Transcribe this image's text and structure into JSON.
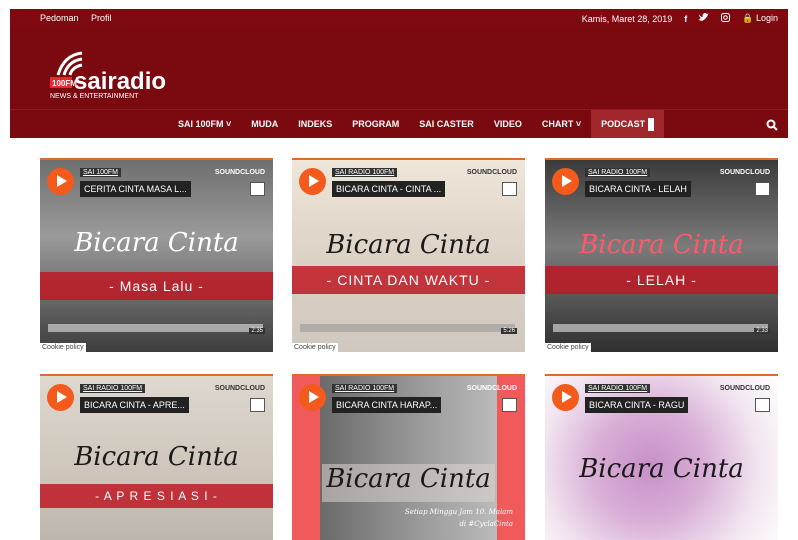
{
  "topbar": {
    "links": [
      "Pedoman",
      "Profil"
    ],
    "date": "Kamis, Maret 28, 2019",
    "login_label": "Login"
  },
  "brand": {
    "logo_number": "100FM",
    "logo_name": "sairadio",
    "tagline": "NEWS & ENTERTAINMENT",
    "color": "#7a0a10"
  },
  "nav": {
    "items": [
      {
        "label": "SAI 100FM ˅"
      },
      {
        "label": "MUDA"
      },
      {
        "label": "INDEKS"
      },
      {
        "label": "PROGRAM"
      },
      {
        "label": "SAI CASTER"
      },
      {
        "label": "VIDEO"
      },
      {
        "label": "CHART ˅"
      },
      {
        "label": "PODCAST"
      }
    ]
  },
  "cards": [
    {
      "user": "SAI 100FM",
      "source": "SOUNDCLOUD",
      "title": "CERITA CINTA MASA L...",
      "script": "Bicara Cinta",
      "band": "- Masa Lalu -",
      "time": "2:35",
      "cookie": "Cookie policy"
    },
    {
      "user": "SAI RADIO 100FM",
      "source": "SOUNDCLOUD",
      "title": "BICARA CINTA - CINTA ...",
      "script": "Bicara Cinta",
      "band": "- CINTA DAN WAKTU -",
      "time": "5:26",
      "cookie": "Cookie policy"
    },
    {
      "user": "SAI RADIO 100FM",
      "source": "SOUNDCLOUD",
      "title": "BICARA CINTA - LELAH",
      "script": "Bicara Cinta",
      "band": "- LELAH -",
      "time": "2:33",
      "cookie": "Cookie policy"
    },
    {
      "user": "SAI RADIO 100FM",
      "source": "SOUNDCLOUD",
      "title": "BICARA CINTA - APRE...",
      "script": "Bicara Cinta",
      "band": "- A P R E S I A S I -",
      "time": "",
      "cookie": ""
    },
    {
      "user": "SAI RADIO 100FM",
      "source": "SOUNDCLOUD",
      "title": "BICARA CINTA HARAP...",
      "script": "Bicara Cinta",
      "band": "",
      "sub1": "Setiap Minggu Jam 10. Malam",
      "sub2": "di #CyclaCinta",
      "time": "",
      "cookie": ""
    },
    {
      "user": "SAI RADIO 100FM",
      "source": "SOUNDCLOUD",
      "title": "BICARA CINTA - RAGU",
      "script": "Bicara Cinta",
      "band": "",
      "time": "",
      "cookie": ""
    }
  ]
}
